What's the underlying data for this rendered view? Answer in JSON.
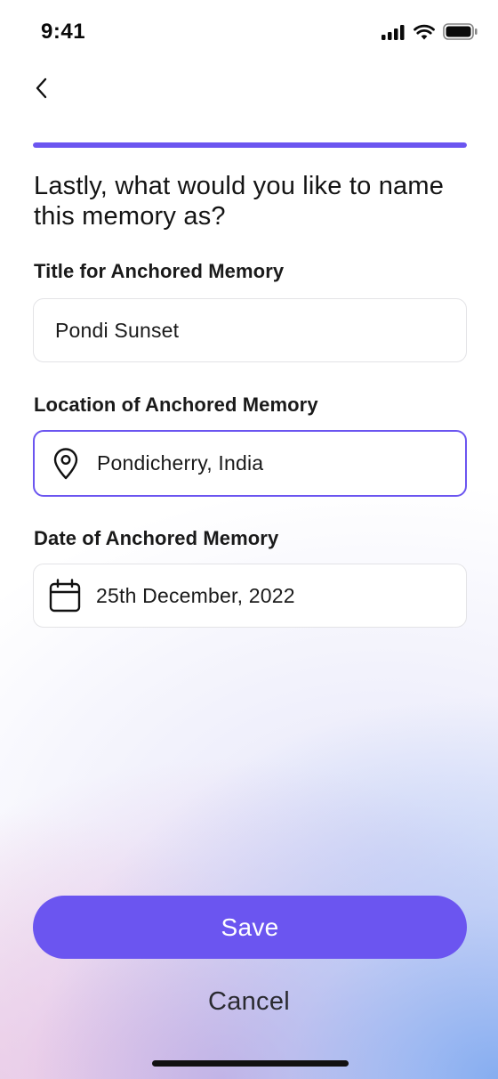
{
  "status_bar": {
    "time": "9:41",
    "icons": [
      "cellular-signal-icon",
      "wifi-icon",
      "battery-icon"
    ]
  },
  "nav": {
    "back_icon": "chevron-left-icon"
  },
  "progress": {
    "value": 1.0,
    "color": "#6b55f0"
  },
  "heading": "Lastly, what would you like to name this memory as?",
  "fields": {
    "title": {
      "label": "Title for Anchored Memory",
      "value": "Pondi Sunset"
    },
    "location": {
      "label": "Location of Anchored Memory",
      "value": "Pondicherry, India",
      "icon": "location-pin-icon",
      "focused": true
    },
    "date": {
      "label": "Date of Anchored Memory",
      "value": "25th December, 2022",
      "icon": "calendar-icon"
    }
  },
  "actions": {
    "save_label": "Save",
    "cancel_label": "Cancel"
  },
  "colors": {
    "accent": "#6b55f0",
    "field_border": "#e3e3e6",
    "text": "#1a1a1a"
  }
}
